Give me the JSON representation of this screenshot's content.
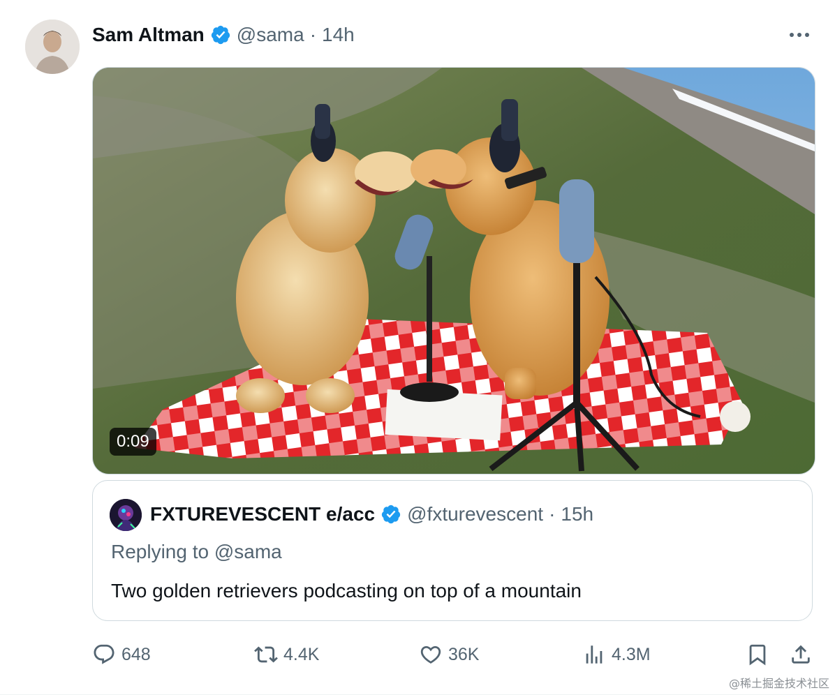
{
  "tweet": {
    "author_name": "Sam Altman",
    "handle": "@sama",
    "separator": "·",
    "time": "14h",
    "avatar_icon": "user-avatar",
    "verified_icon": "verified-badge-icon",
    "more_icon": "more-horizontal-icon"
  },
  "media": {
    "duration": "0:09"
  },
  "quote": {
    "author_name": "FXTUREVESCENT e/acc",
    "handle": "@fxturevescent",
    "separator": "·",
    "time": "15h",
    "replying_to": "Replying to @sama",
    "text": "Two golden retrievers podcasting on top of a mountain"
  },
  "actions": {
    "replies": "648",
    "reposts": "4.4K",
    "likes": "36K",
    "views": "4.3M",
    "reply_icon": "reply-icon",
    "repost_icon": "repost-icon",
    "like_icon": "heart-icon",
    "views_icon": "views-chart-icon",
    "bookmark_icon": "bookmark-icon",
    "share_icon": "share-icon"
  },
  "watermark": "@稀土掘金技术社区",
  "colors": {
    "verified": "#1d9bf0",
    "secondary_text": "#536471",
    "primary_text": "#0f1419",
    "border": "#cfd9de"
  }
}
